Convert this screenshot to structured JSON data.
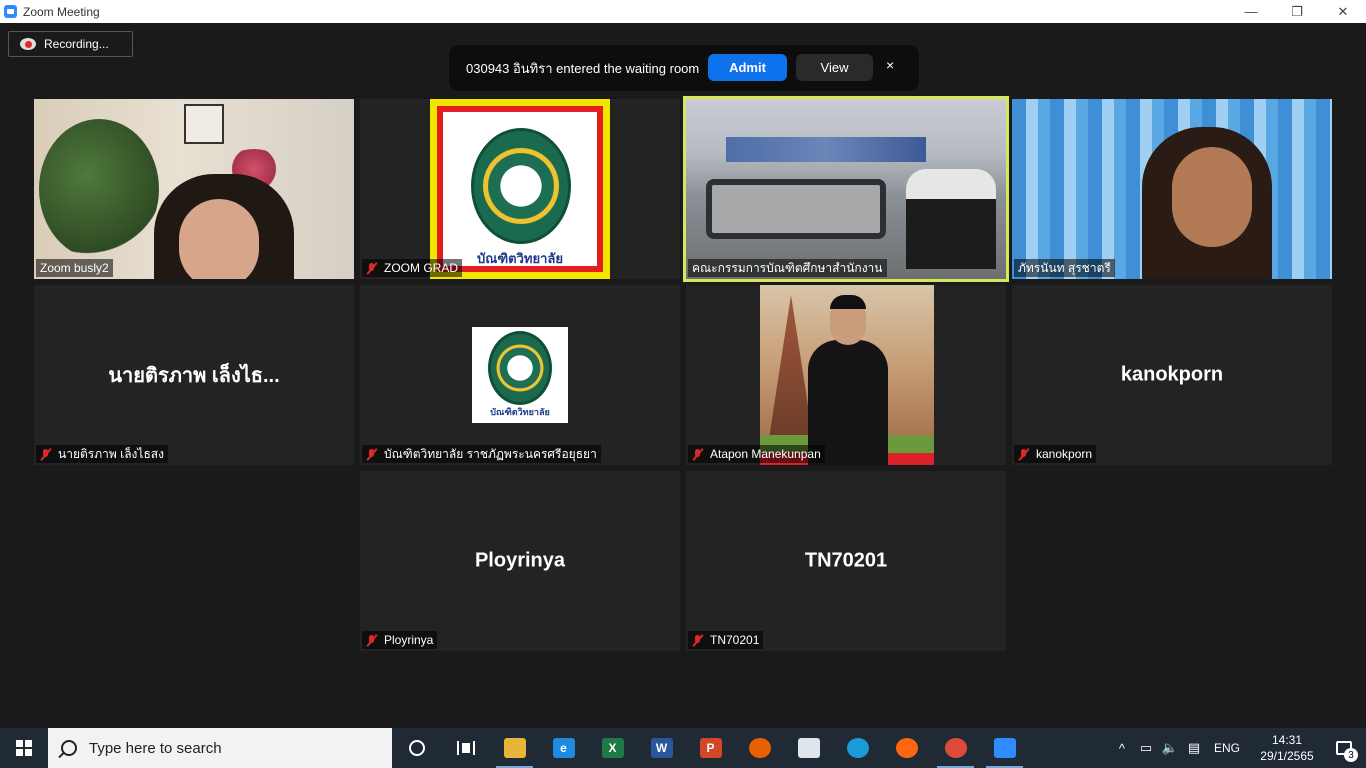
{
  "window": {
    "title": "Zoom Meeting",
    "controls": {
      "minimize": "—",
      "restore": "❐",
      "close": "✕"
    }
  },
  "recording": {
    "label": "Recording..."
  },
  "waiting_room": {
    "message": "030943 อินทิรา entered the waiting room",
    "admit_label": "Admit",
    "view_label": "View",
    "close_label": "×"
  },
  "participants": [
    {
      "name": "Zoom busly2",
      "muted": false,
      "video": "kitchen"
    },
    {
      "name": "ZOOM GRAD",
      "muted": true,
      "video": "logo",
      "logo_text": "บัณฑิตวิทยาลัย"
    },
    {
      "name": "คณะกรรมการบัณฑิตศึกษาสำนักงาน",
      "muted": false,
      "video": "meeting-room",
      "active_speaker": true
    },
    {
      "name": "ภัทรนันท สุรชาตรี",
      "muted": false,
      "video": "curtain"
    },
    {
      "name": "นายติรภาพ  เล็งไธสง",
      "display": "นายติรภาพ  เล็งไธ...",
      "muted": true,
      "video": "none"
    },
    {
      "name": "บัณฑิตวิทยาลัย ราชภัฏพระนครศรีอยุธยา",
      "muted": true,
      "video": "logo-small",
      "logo_text": "บัณฑิตวิทยาลัย"
    },
    {
      "name": "Atapon Manekunpan",
      "muted": true,
      "video": "temple"
    },
    {
      "name": "kanokporn",
      "display": "kanokporn",
      "muted": true,
      "video": "none"
    },
    {
      "name": "Ployrinya",
      "display": "Ployrinya",
      "muted": true,
      "video": "none"
    },
    {
      "name": "TN70201",
      "display": "TN70201",
      "muted": true,
      "video": "none"
    }
  ],
  "taskbar": {
    "search_placeholder": "Type here to search",
    "apps": [
      {
        "name": "file-explorer",
        "glyph": "",
        "color": "#e8b43a"
      },
      {
        "name": "internet-explorer",
        "glyph": "e",
        "color": "#1f8be0"
      },
      {
        "name": "excel",
        "glyph": "X",
        "color": "#1d7a45"
      },
      {
        "name": "word",
        "glyph": "W",
        "color": "#2b579a"
      },
      {
        "name": "powerpoint",
        "glyph": "P",
        "color": "#d24726"
      },
      {
        "name": "firefox",
        "glyph": "",
        "color": "#e66000"
      },
      {
        "name": "store",
        "glyph": "",
        "color": "#dfe5ea"
      },
      {
        "name": "edge",
        "glyph": "",
        "color": "#1a9bd7"
      },
      {
        "name": "firefox-2",
        "glyph": "",
        "color": "#ff6611"
      },
      {
        "name": "chrome",
        "glyph": "",
        "color": "#dd4b39"
      },
      {
        "name": "zoom",
        "glyph": "",
        "color": "#2d8cff"
      }
    ],
    "tray": {
      "chevron": "^",
      "lang": "ENG",
      "time": "14:31",
      "date": "29/1/2565",
      "notifications": "3"
    }
  }
}
